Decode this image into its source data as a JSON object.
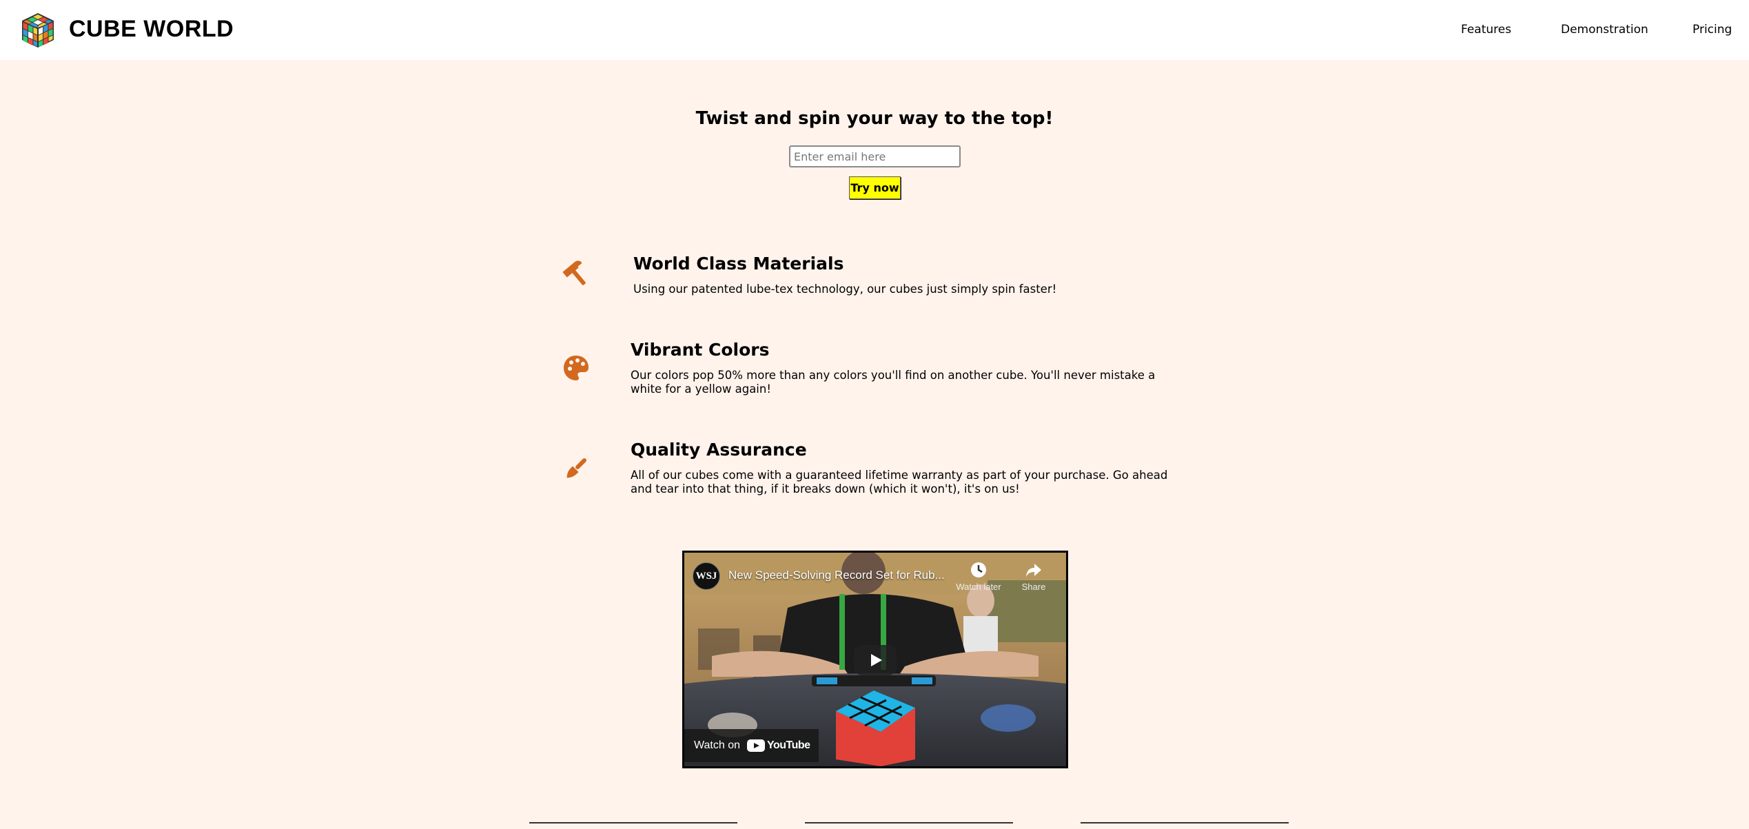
{
  "header": {
    "brand": "CUBE WORLD",
    "logo_icon": "rubiks-cube-icon",
    "nav": [
      {
        "label": "Features"
      },
      {
        "label": "Demonstration"
      },
      {
        "label": "Pricing"
      }
    ]
  },
  "hero": {
    "title": "Twist and spin your way to the top!",
    "email_placeholder": "Enter email here",
    "cta_label": "Try now"
  },
  "features": [
    {
      "icon": "hammer-icon",
      "title": "World Class Materials",
      "text": "Using our patented lube-tex technology, our cubes just simply spin faster!"
    },
    {
      "icon": "palette-icon",
      "title": "Vibrant Colors",
      "text": "Our colors pop 50% more than any colors you'll find on another cube. You'll never mistake a white for a yellow again!"
    },
    {
      "icon": "paintbrush-icon",
      "title": "Quality Assurance",
      "text": "All of our cubes come with a guaranteed lifetime warranty as part of your purchase. Go ahead and tear into that thing, if it breaks down (which it won't), it's on us!"
    }
  ],
  "video": {
    "channel": "WSJ",
    "title": "New Speed-Solving Record Set for Rub...",
    "watch_later": "Watch later",
    "share": "Share",
    "watch_on": "Watch on",
    "platform": "YouTube"
  },
  "colors": {
    "page_bg": "#fff3ec",
    "accent_icon": "#d2691e",
    "cta_bg": "#ffff00"
  }
}
